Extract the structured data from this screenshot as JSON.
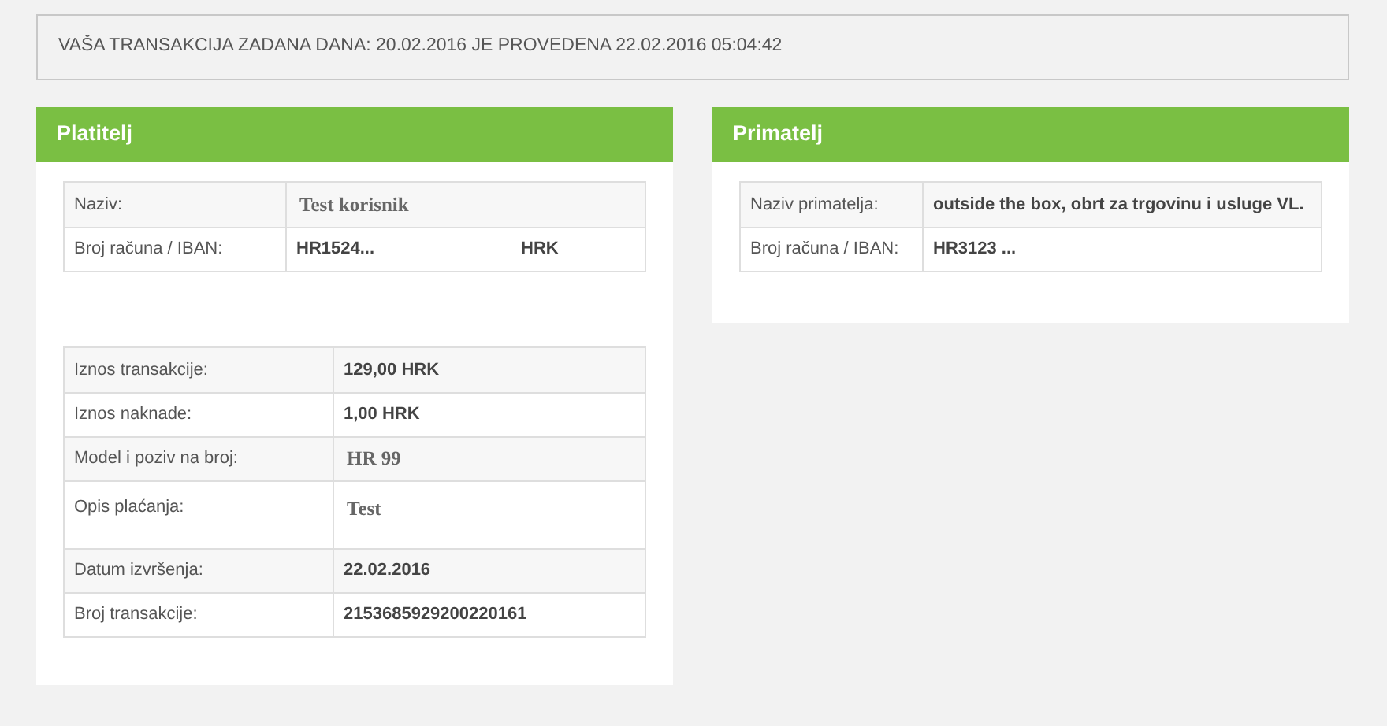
{
  "notice": "VAŠA TRANSAKCIJA ZADANA DANA: 20.02.2016 JE PROVEDENA 22.02.2016 05:04:42",
  "payer": {
    "title": "Platitelj",
    "account_rows": [
      {
        "label": "Naziv:",
        "value": "Test korisnik",
        "kind": "serif"
      },
      {
        "label": "Broj računa / IBAN:",
        "value": "HR1524...",
        "currency": "HRK",
        "kind": "bold"
      }
    ],
    "detail_rows": [
      {
        "label": "Iznos transakcije:",
        "value": "129,00 HRK",
        "kind": "bold"
      },
      {
        "label": "Iznos naknade:",
        "value": "1,00 HRK",
        "kind": "bold"
      },
      {
        "label": "Model i poziv na broj:",
        "value": "HR 99",
        "kind": "serif"
      },
      {
        "label": "Opis plaćanja:",
        "value": "Test",
        "kind": "serif-tall"
      },
      {
        "label": "Datum izvršenja:",
        "value": "22.02.2016",
        "kind": "bold"
      },
      {
        "label": "Broj transakcije:",
        "value": "2153685929200220161",
        "kind": "bold"
      }
    ]
  },
  "payee": {
    "title": "Primatelj",
    "account_rows": [
      {
        "label": "Naziv primatelja:",
        "value": "outside the box, obrt za trgovinu i usluge VL.",
        "kind": "bold"
      },
      {
        "label": "Broj računa / IBAN:",
        "value": "HR3123 ...",
        "kind": "bold"
      }
    ]
  }
}
